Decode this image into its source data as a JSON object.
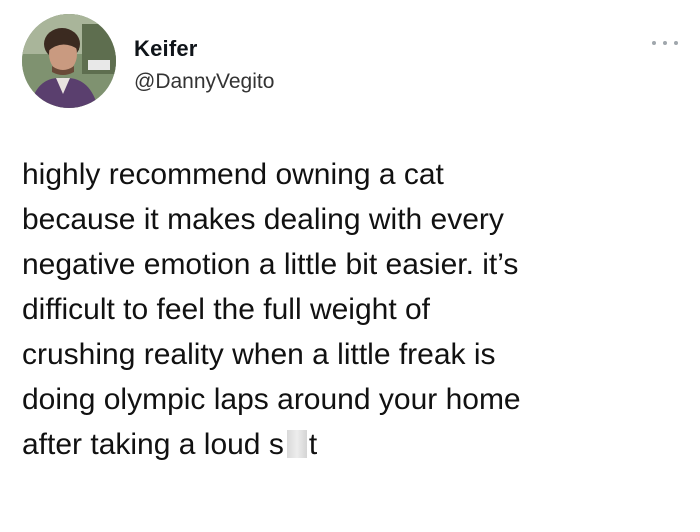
{
  "author": {
    "display_name": "Keifer",
    "handle": "@DannyVegito",
    "avatar_icon": "profile-photo"
  },
  "more_icon": "more-horizontal-icon",
  "tweet": {
    "lines": [
      "highly recommend owning a cat",
      "because it makes dealing with every",
      "negative emotion a little bit easier. it’s",
      "difficult to feel the full weight of",
      "crushing reality when a little freak is",
      "doing olympic laps around your home"
    ],
    "last_line_before": "after taking a loud s",
    "last_line_after": "t"
  },
  "colors": {
    "name": "#0f1419",
    "handle": "#333333",
    "text": "#111111",
    "censor": "#dcdcdc"
  }
}
